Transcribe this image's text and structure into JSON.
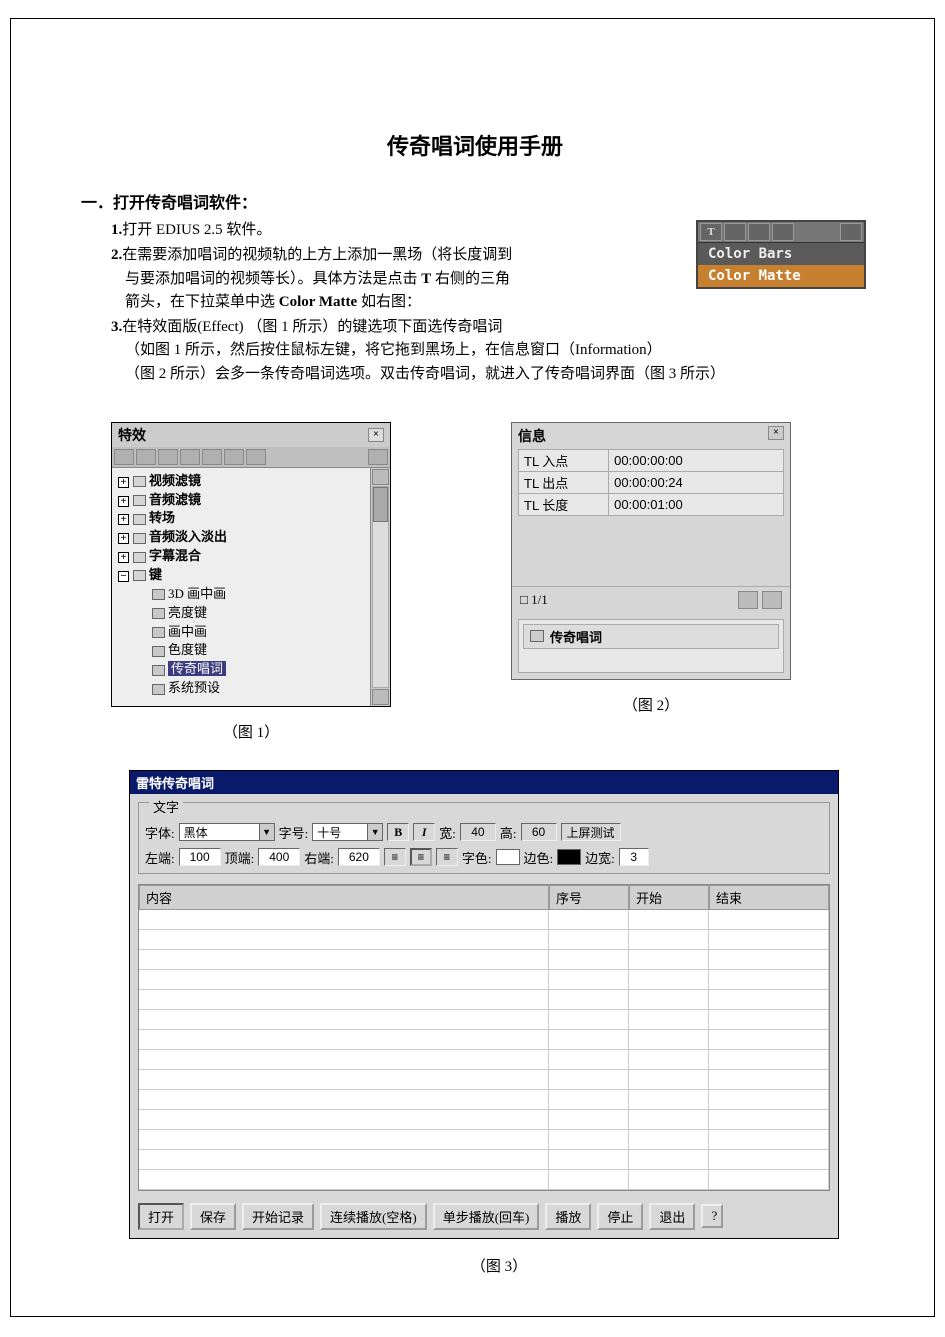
{
  "doc": {
    "title": "传奇唱词使用手册",
    "section1_title": "一．打开传奇唱词软件：",
    "li1": "打开 EDIUS  2.5 软件。",
    "li2a": "在需要添加唱词的视频轨的上方上添加一黑场（将长度调到",
    "li2b": "与要添加唱词的视频等长）。具体方法是点击 ",
    "li2b_bold": "T",
    "li2c": " 右侧的三角",
    "li2d": "箭头，在下拉菜单中选 ",
    "li2d_bold": "Color Matte",
    "li2e": " 如右图：",
    "li3a": "在特效面版(Effect)  （图 1 所示）的键选项下面选传奇唱词",
    "li3b": "（如图 1 所示，然后按住鼠标左键，将它拖到黑场上，在信息窗口（Information）",
    "li3c": "（图 2 所示）会多一条传奇唱词选项。双击传奇唱词，就进入了传奇唱词界面（图 3 所示）"
  },
  "dropdown": {
    "item1": "Color Bars",
    "item2": "Color Matte"
  },
  "panel1": {
    "title": "特效",
    "tree": {
      "n1": "视频滤镜",
      "n2": "音频滤镜",
      "n3": "转场",
      "n4": "音频淡入淡出",
      "n5": "字幕混合",
      "n6": "键",
      "c1": "3D 画中画",
      "c2": "亮度键",
      "c3": "画中画",
      "c4": "色度键",
      "c5": "传奇唱词",
      "c6": "系统预设"
    }
  },
  "panel2": {
    "title": "信息",
    "rows": {
      "k1": "TL 入点",
      "v1": "00:00:00:00",
      "k2": "TL 出点",
      "v2": "00:00:00:24",
      "k3": "TL 长度",
      "v3": "00:00:01:00"
    },
    "pager": "1/1",
    "effect": "传奇唱词"
  },
  "captions": {
    "fig1": "（图  1）",
    "fig2": "（图 2）",
    "fig3": "（图  3）"
  },
  "win3": {
    "title": "雷特传奇唱词",
    "group": "文字",
    "row1": {
      "font_lbl": "字体:",
      "font_val": "黑体",
      "size_lbl": "字号:",
      "size_val": "十号",
      "b": "B",
      "i": "I",
      "w_lbl": "宽:",
      "w_val": "40",
      "h_lbl": "高:",
      "h_val": "60",
      "screen_test": "上屏测试"
    },
    "row2": {
      "left_lbl": "左端:",
      "left_val": "100",
      "top_lbl": "顶端:",
      "top_val": "400",
      "right_lbl": "右端:",
      "right_val": "620",
      "al": "≡",
      "ac": "≡",
      "ar": "≡",
      "fg_lbl": "字色:",
      "edge_lbl": "边色:",
      "bw_lbl": "边宽:",
      "bw_val": "3"
    },
    "grid": {
      "h1": "内容",
      "h2": "序号",
      "h3": "开始",
      "h4": "结束"
    },
    "btns": {
      "open": "打开",
      "save": "保存",
      "rec": "开始记录",
      "playc": "连续播放(空格)",
      "step": "单步播放(回车)",
      "play": "播放",
      "stop": "停止",
      "exit": "退出",
      "help": "?"
    }
  }
}
